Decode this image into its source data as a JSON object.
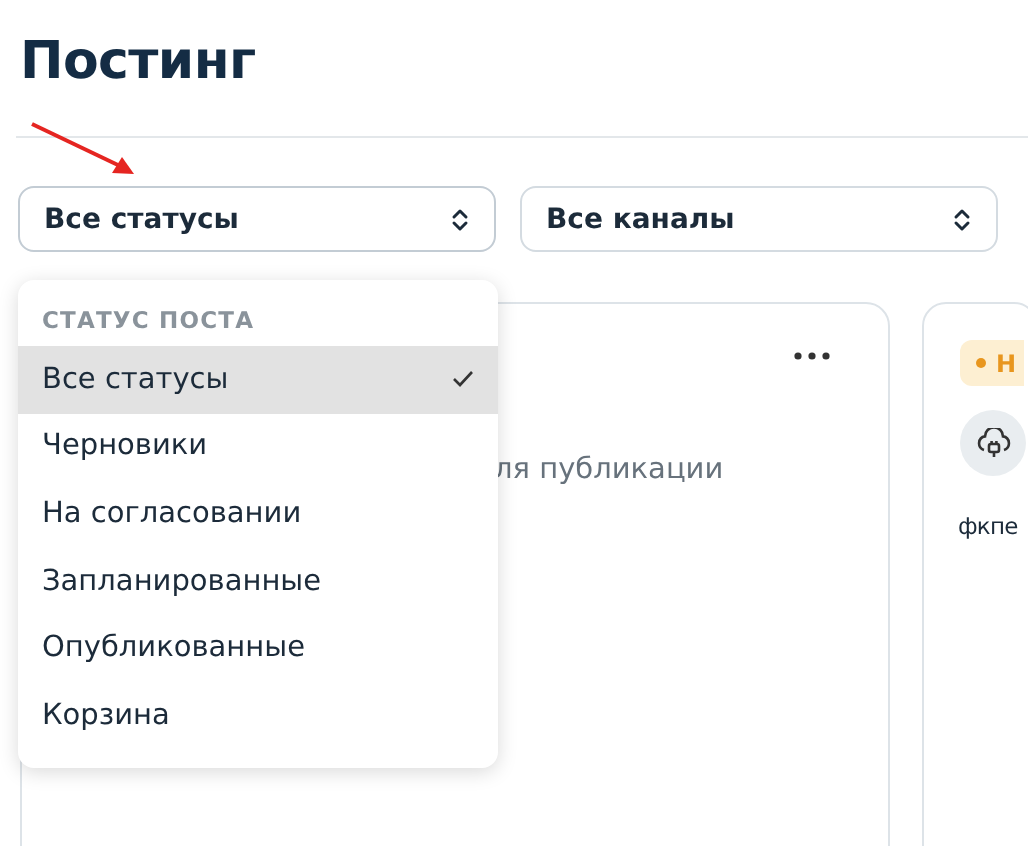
{
  "page": {
    "title": "Постинг"
  },
  "filters": [
    {
      "value": "Все статусы",
      "expanded": true
    },
    {
      "value": "Все каналы",
      "expanded": false
    }
  ],
  "status_menu": {
    "header": "СТАТУС ПОСТА",
    "items": [
      {
        "label": "Все статусы",
        "selected": true
      },
      {
        "label": "Черновики",
        "selected": false
      },
      {
        "label": "На согласовании",
        "selected": false
      },
      {
        "label": "Запланированные",
        "selected": false
      },
      {
        "label": "Опубликованные",
        "selected": false
      },
      {
        "label": "Корзина",
        "selected": false
      }
    ]
  },
  "cards": [
    {
      "kind": "empty",
      "text": "ля публикации"
    },
    {
      "kind": "post",
      "badge": "Н",
      "text": "фкпе"
    }
  ]
}
